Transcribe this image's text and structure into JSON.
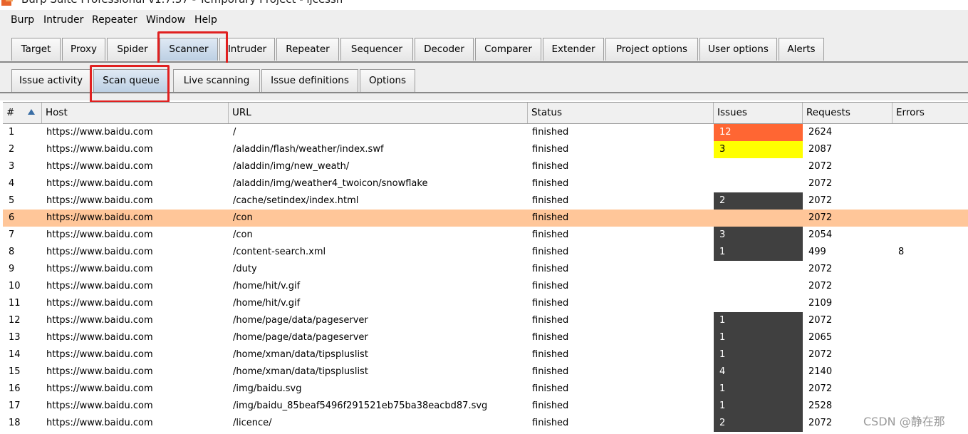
{
  "title_bar": {
    "text": "Burp Suite Professional v1.7.37 - Temporary Project - ljcessh"
  },
  "menu": [
    "Burp",
    "Intruder",
    "Repeater",
    "Window",
    "Help"
  ],
  "main_tabs": [
    "Target",
    "Proxy",
    "Spider",
    "Scanner",
    "Intruder",
    "Repeater",
    "Sequencer",
    "Decoder",
    "Comparer",
    "Extender",
    "Project options",
    "User options",
    "Alerts"
  ],
  "selected_main_tab": "Scanner",
  "sub_tabs": [
    "Issue activity",
    "Scan queue",
    "Live scanning",
    "Issue definitions",
    "Options"
  ],
  "selected_sub_tab": "Scan queue",
  "columns": [
    "#",
    "Host",
    "URL",
    "Status",
    "Issues",
    "Requests",
    "Errors"
  ],
  "rows": [
    {
      "num": "1",
      "host": "https://www.baidu.com",
      "url": "/",
      "status": "finished",
      "issues": "12",
      "issue_color": "#ff6633",
      "issue_text_color": "#ffffff",
      "requests": "2624",
      "errors": ""
    },
    {
      "num": "2",
      "host": "https://www.baidu.com",
      "url": "/aladdin/flash/weather/index.swf",
      "status": "finished",
      "issues": "3",
      "issue_color": "#ffff00",
      "issue_text_color": "#000000",
      "requests": "2087",
      "errors": ""
    },
    {
      "num": "3",
      "host": "https://www.baidu.com",
      "url": "/aladdin/img/new_weath/",
      "status": "finished",
      "issues": "",
      "issue_color": "",
      "issue_text_color": "",
      "requests": "2072",
      "errors": ""
    },
    {
      "num": "4",
      "host": "https://www.baidu.com",
      "url": "/aladdin/img/weather4_twoicon/snowflake",
      "status": "finished",
      "issues": "",
      "issue_color": "",
      "issue_text_color": "",
      "requests": "2072",
      "errors": ""
    },
    {
      "num": "5",
      "host": "https://www.baidu.com",
      "url": "/cache/setindex/index.html",
      "status": "finished",
      "issues": "2",
      "issue_color": "#404040",
      "issue_text_color": "#ffffff",
      "requests": "2072",
      "errors": ""
    },
    {
      "num": "6",
      "host": "https://www.baidu.com",
      "url": "/con",
      "status": "finished",
      "issues": "",
      "issue_color": "",
      "issue_text_color": "",
      "requests": "2072",
      "errors": "",
      "highlight": true
    },
    {
      "num": "7",
      "host": "https://www.baidu.com",
      "url": "/con",
      "status": "finished",
      "issues": "3",
      "issue_color": "#404040",
      "issue_text_color": "#ffffff",
      "requests": "2054",
      "errors": ""
    },
    {
      "num": "8",
      "host": "https://www.baidu.com",
      "url": "/content-search.xml",
      "status": "finished",
      "issues": "1",
      "issue_color": "#404040",
      "issue_text_color": "#ffffff",
      "requests": "499",
      "errors": "8"
    },
    {
      "num": "9",
      "host": "https://www.baidu.com",
      "url": "/duty",
      "status": "finished",
      "issues": "",
      "issue_color": "",
      "issue_text_color": "",
      "requests": "2072",
      "errors": ""
    },
    {
      "num": "10",
      "host": "https://www.baidu.com",
      "url": "/home/hit/v.gif",
      "status": "finished",
      "issues": "",
      "issue_color": "",
      "issue_text_color": "",
      "requests": "2072",
      "errors": ""
    },
    {
      "num": "11",
      "host": "https://www.baidu.com",
      "url": "/home/hit/v.gif",
      "status": "finished",
      "issues": "",
      "issue_color": "",
      "issue_text_color": "",
      "requests": "2109",
      "errors": ""
    },
    {
      "num": "12",
      "host": "https://www.baidu.com",
      "url": "/home/page/data/pageserver",
      "status": "finished",
      "issues": "1",
      "issue_color": "#404040",
      "issue_text_color": "#ffffff",
      "requests": "2072",
      "errors": ""
    },
    {
      "num": "13",
      "host": "https://www.baidu.com",
      "url": "/home/page/data/pageserver",
      "status": "finished",
      "issues": "1",
      "issue_color": "#404040",
      "issue_text_color": "#ffffff",
      "requests": "2065",
      "errors": ""
    },
    {
      "num": "14",
      "host": "https://www.baidu.com",
      "url": "/home/xman/data/tipspluslist",
      "status": "finished",
      "issues": "1",
      "issue_color": "#404040",
      "issue_text_color": "#ffffff",
      "requests": "2072",
      "errors": ""
    },
    {
      "num": "15",
      "host": "https://www.baidu.com",
      "url": "/home/xman/data/tipspluslist",
      "status": "finished",
      "issues": "4",
      "issue_color": "#404040",
      "issue_text_color": "#ffffff",
      "requests": "2140",
      "errors": ""
    },
    {
      "num": "16",
      "host": "https://www.baidu.com",
      "url": "/img/baidu.svg",
      "status": "finished",
      "issues": "1",
      "issue_color": "#404040",
      "issue_text_color": "#ffffff",
      "requests": "2072",
      "errors": ""
    },
    {
      "num": "17",
      "host": "https://www.baidu.com",
      "url": "/img/baidu_85beaf5496f291521eb75ba38eacbd87.svg",
      "status": "finished",
      "issues": "1",
      "issue_color": "#404040",
      "issue_text_color": "#ffffff",
      "requests": "2528",
      "errors": ""
    },
    {
      "num": "18",
      "host": "https://www.baidu.com",
      "url": "/licence/",
      "status": "finished",
      "issues": "2",
      "issue_color": "#404040",
      "issue_text_color": "#ffffff",
      "requests": "2072",
      "errors": ""
    }
  ],
  "watermark": "CSDN @静在那",
  "colors": {
    "highlight_row": "#ffc699",
    "selected_tab": "#c8d9ea",
    "annotation_box": "#e02020"
  }
}
